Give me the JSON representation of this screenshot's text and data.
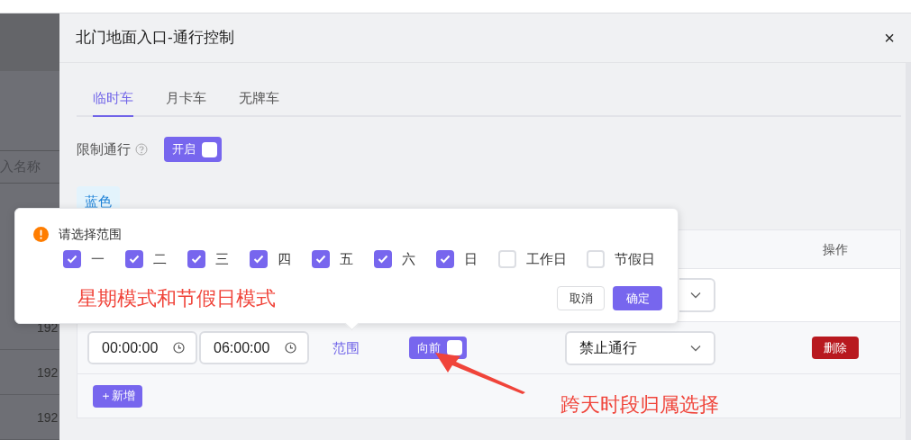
{
  "background": {
    "search_placeholder": "入名称",
    "rows": [
      "192",
      "192",
      "192"
    ]
  },
  "dialog": {
    "title": "北门地面入口-通行控制",
    "close": "×",
    "tabs": [
      {
        "label": "临时车",
        "selected": true
      },
      {
        "label": "月卡车",
        "selected": false
      },
      {
        "label": "无牌车",
        "selected": false
      }
    ],
    "restrict": {
      "label": "限制通行",
      "switch": {
        "label": "开启",
        "on": true
      }
    },
    "plate_tag": "蓝色",
    "table": {
      "columns": [
        {
          "label": "操作"
        }
      ],
      "rows": [
        {
          "start_time": "00:00:00",
          "end_time": "06:00:00",
          "range_link": "范围",
          "direction_switch": {
            "label": "向前",
            "on": true
          },
          "action": "禁止通行",
          "delete": "删除"
        }
      ]
    },
    "add_button": "＋新增"
  },
  "popover": {
    "title": "请选择范围",
    "options": [
      {
        "label": "一",
        "checked": true
      },
      {
        "label": "二",
        "checked": true
      },
      {
        "label": "三",
        "checked": true
      },
      {
        "label": "四",
        "checked": true
      },
      {
        "label": "五",
        "checked": true
      },
      {
        "label": "六",
        "checked": true
      },
      {
        "label": "日",
        "checked": true
      },
      {
        "label": "工作日",
        "checked": false
      },
      {
        "label": "节假日",
        "checked": false
      }
    ],
    "cancel": "取消",
    "confirm": "确定"
  },
  "annotations": [
    {
      "text": "星期模式和节假日模式"
    },
    {
      "text": "跨天时段归属选择"
    }
  ]
}
